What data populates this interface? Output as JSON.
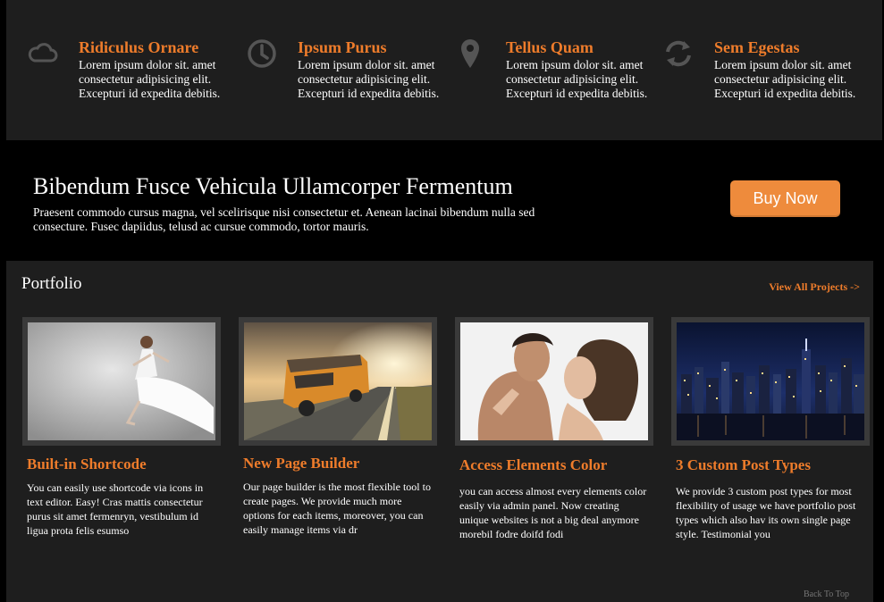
{
  "features": [
    {
      "icon": "cloud-icon",
      "title": "Ridiculus Ornare",
      "text": "Lorem ipsum dolor sit. amet consectetur adipisicing elit. Excepturi id expedita debitis."
    },
    {
      "icon": "clock-icon",
      "title": "Ipsum Purus",
      "text": "Lorem ipsum dolor sit. amet consectetur adipisicing elit. Excepturi id expedita debitis."
    },
    {
      "icon": "map-pin-icon",
      "title": "Tellus Quam",
      "text": "Lorem ipsum dolor sit. amet consectetur adipisicing elit. Excepturi id expedita debitis."
    },
    {
      "icon": "refresh-icon",
      "title": "Sem Egestas",
      "text": "Lorem ipsum dolor sit. amet consectetur adipisicing elit. Excepturi id expedita debitis."
    }
  ],
  "promo": {
    "heading": "Bibendum Fusce Vehicula Ullamcorper Fermentum",
    "text": "Praesent commodo cursus magna, vel scelirisque nisi consectetur et. Aenean lacinai bibendum nulla sed consecture. Fusec dapiidus, telusd ac cursue commodo, tortor mauris.",
    "button_label": "Buy Now"
  },
  "portfolio": {
    "title": "Portfolio",
    "view_all": "View All Projects ->",
    "items": [
      {
        "image": "dancer-photo",
        "title": "Built-in Shortcode",
        "text": "You can easily use shortcode via icons in text editor. Easy! Cras mattis consectetur purus sit amet fermenryn, vestibulum id ligua prota felis esumso"
      },
      {
        "image": "bus-photo",
        "title": "New Page Builder",
        "text": "Our page builder is the most flexible tool to create pages. We provide much more options for each items, moreover, you can easily manage items via dr"
      },
      {
        "image": "couple-photo",
        "title": "Access Elements Color",
        "text": "you can access almost every elements color easily via admin panel. Now creating unique websites is not a big deal anymore morebil fodre doifd fodi"
      },
      {
        "image": "city-night-photo",
        "title": "3 Custom Post Types",
        "text": "We provide 3 custom post types for most flexibility of usage we have portfolio post types which also hav its own single page style. Testimonial you"
      }
    ]
  },
  "footer": {
    "back_to_top": "Back To Top"
  },
  "colors": {
    "accent": "#ee7c2b",
    "button": "#ee8b3c",
    "panel": "#1e1e1e",
    "icon": "#555555"
  }
}
